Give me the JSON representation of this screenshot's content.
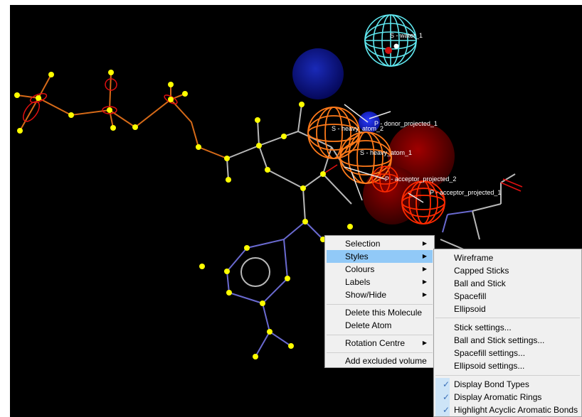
{
  "labels3d": {
    "water": "S - water_1",
    "donor": "P - donor_projected_1",
    "heavy2": "S - heavy_atom_2",
    "heavy1": "S - heavy_atom_1",
    "acceptor2": "P - acceptor_projected_2",
    "acceptor1": "P - acceptor_projected_1"
  },
  "context_menu": {
    "items": [
      {
        "label": "Selection",
        "submenu": true
      },
      {
        "label": "Styles",
        "submenu": true,
        "highlighted": true
      },
      {
        "label": "Colours",
        "submenu": true
      },
      {
        "label": "Labels",
        "submenu": true
      },
      {
        "label": "Show/Hide",
        "submenu": true
      },
      {
        "label": "Delete this Molecule"
      },
      {
        "label": "Delete Atom"
      },
      {
        "label": "Rotation Centre",
        "submenu": true
      },
      {
        "label": "Add excluded volume"
      }
    ]
  },
  "styles_submenu": {
    "items": [
      {
        "label": "Wireframe"
      },
      {
        "label": "Capped Sticks"
      },
      {
        "label": "Ball and Stick"
      },
      {
        "label": "Spacefill"
      },
      {
        "label": "Ellipsoid"
      },
      {
        "label": "Stick settings..."
      },
      {
        "label": "Ball and Stick settings..."
      },
      {
        "label": "Spacefill settings..."
      },
      {
        "label": "Ellipsoid settings..."
      },
      {
        "label": "Display Bond Types",
        "checked": true
      },
      {
        "label": "Display Aromatic Rings",
        "checked": true
      },
      {
        "label": "Highlight Acyclic Aromatic Bonds",
        "checked": true
      }
    ]
  },
  "colors": {
    "background": "#000000",
    "menu_highlight": "#91c9f7",
    "atom": "#ffff00",
    "water_mesh": "#5fe6ee",
    "heavy_mesh": "#ff7a1a",
    "acceptor_mesh": "#ff2a00",
    "donor_sphere": "#0a1496"
  },
  "icons": {
    "submenu_arrow": "triangle-right-icon",
    "check": "checkmark-icon"
  }
}
